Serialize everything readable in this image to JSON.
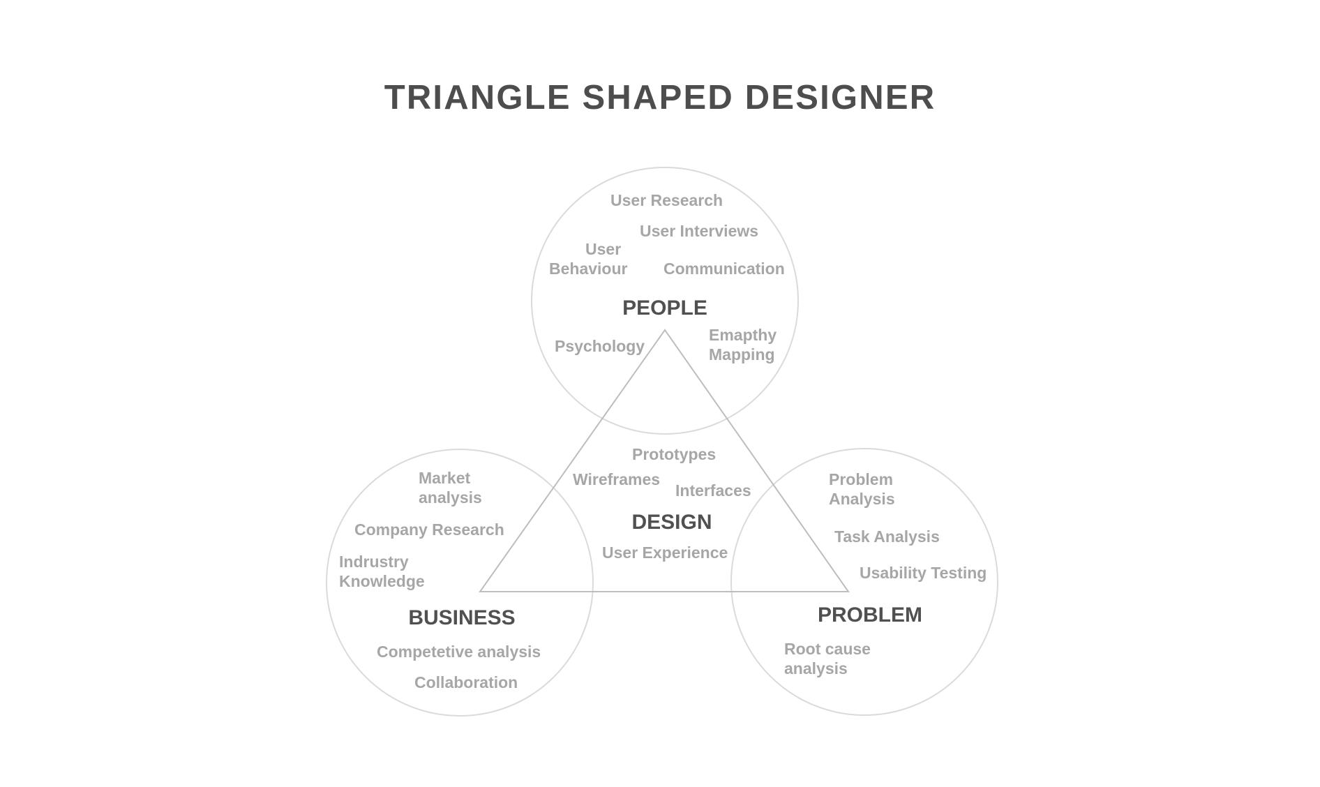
{
  "title": "TRIANGLE SHAPED DESIGNER",
  "colors": {
    "title": "#4d4d4d",
    "group_label": "#505050",
    "item": "#a6a6a6",
    "circle_stroke": "#dadada",
    "triangle_stroke": "#bdbdbd",
    "background": "#ffffff"
  },
  "groups": {
    "people": {
      "label": "PEOPLE",
      "items": {
        "user_research": "User Research",
        "user_interviews": "User Interviews",
        "user_behaviour_line1": "User",
        "user_behaviour_line2": "Behaviour",
        "communication": "Communication",
        "psychology": "Psychology",
        "empathy_line1": "Emapthy",
        "empathy_line2": "Mapping"
      }
    },
    "design": {
      "label": "DESIGN",
      "items": {
        "prototypes": "Prototypes",
        "wireframes": "Wireframes",
        "interfaces": "Interfaces",
        "user_experience": "User Experience"
      }
    },
    "business": {
      "label": "BUSINESS",
      "items": {
        "market_line1": "Market",
        "market_line2": "analysis",
        "company_research": "Company Research",
        "industry_line1": "Indrustry",
        "industry_line2": "Knowledge",
        "competetive_analysis": "Competetive analysis",
        "collaboration": "Collaboration"
      }
    },
    "problem": {
      "label": "PROBLEM",
      "items": {
        "problem_analysis_line1": "Problem",
        "problem_analysis_line2": "Analysis",
        "task_analysis": "Task Analysis",
        "usability_testing": "Usability Testing",
        "root_cause_line1": "Root cause",
        "root_cause_line2": "analysis"
      }
    }
  }
}
